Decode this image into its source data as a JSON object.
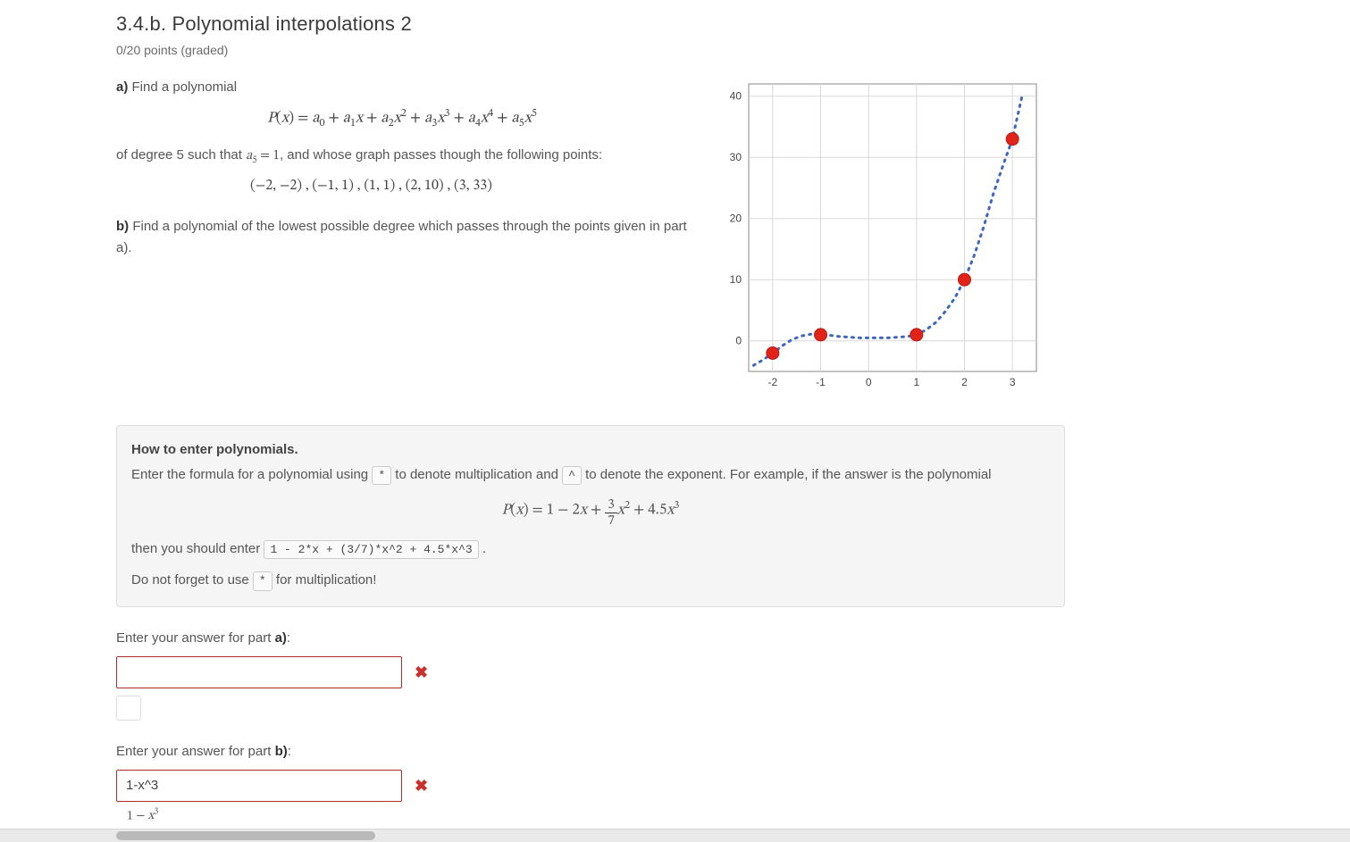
{
  "header": {
    "title": "3.4.b. Polynomial interpolations 2",
    "points": "0/20 points (graded)"
  },
  "partA": {
    "lead_label": "a)",
    "lead_text": " Find a polynomial",
    "tail_before": "of degree 5 such that ",
    "tail_cond": "a₅ = 1",
    "tail_after": ", and whose graph passes though the following points:",
    "points_list": "(−2, −2) ,  (−1, 1) ,  (1, 1) ,  (2, 10) ,  (3, 33)"
  },
  "partB": {
    "label": "b)",
    "text": " Find a polynomial of the lowest possible degree which passes through the points given in part a)."
  },
  "help": {
    "title": "How to enter polynomials.",
    "line1_a": "Enter the formula for a polynomial using ",
    "kbd_star": "*",
    "line1_b": " to denote multiplication and ",
    "kbd_caret": "^",
    "line1_c": " to denote the exponent. For example, if the answer is the polynomial",
    "line2_a": "then you should enter ",
    "kbd_example": "1 - 2*x + (3/7)*x^2 + 4.5*x^3",
    "line2_b": " .",
    "line3_a": "Do not forget to use ",
    "line3_b": " for multiplication!"
  },
  "answers": {
    "a": {
      "label_pre": "Enter your answer for part ",
      "label_part": "a)",
      "label_post": ":",
      "value": ""
    },
    "b": {
      "label_pre": "Enter your answer for part ",
      "label_part": "b)",
      "label_post": ":",
      "value": "1-x^3",
      "preview_lhs": "1",
      "preview_rhs": " − x³"
    }
  },
  "chart_data": {
    "type": "scatter",
    "title": "",
    "xlabel": "",
    "ylabel": "",
    "xlim": [
      -2.5,
      3.5
    ],
    "ylim": [
      -5,
      42
    ],
    "xticks": [
      -2,
      -1,
      0,
      1,
      2,
      3
    ],
    "yticks": [
      0,
      10,
      20,
      30,
      40
    ],
    "series": [
      {
        "name": "polynomial-curve",
        "style": "dotted",
        "x": [
          -2.4,
          -2.2,
          -2.0,
          -1.8,
          -1.6,
          -1.4,
          -1.2,
          -1.0,
          -0.8,
          -0.6,
          -0.4,
          -0.2,
          0.0,
          0.2,
          0.4,
          0.6,
          0.8,
          1.0,
          1.2,
          1.4,
          1.6,
          1.8,
          2.0,
          2.2,
          2.4,
          2.6,
          2.8,
          3.0,
          3.2
        ],
        "y": [
          -4.0,
          -3.1,
          -2.0,
          -0.8,
          0.2,
          0.8,
          1.1,
          1.0,
          0.9,
          0.7,
          0.6,
          0.5,
          0.5,
          0.5,
          0.5,
          0.6,
          0.7,
          1.0,
          1.8,
          3.0,
          4.8,
          7.0,
          10.0,
          13.9,
          18.6,
          24.0,
          28.6,
          33.0,
          40.0
        ]
      },
      {
        "name": "given-points",
        "style": "points",
        "x": [
          -2,
          -1,
          1,
          2,
          3
        ],
        "y": [
          -2,
          1,
          1,
          10,
          33
        ]
      }
    ]
  }
}
